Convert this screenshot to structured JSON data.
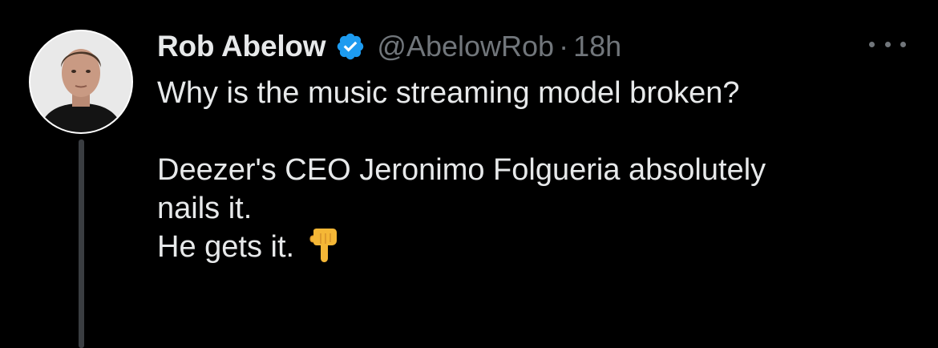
{
  "author": {
    "name": "Rob Abelow",
    "handle": "@AbelowRob",
    "separator": "·",
    "time": "18h",
    "verified": true,
    "avatar": "profile-photo"
  },
  "menu_icon": "more-horizontal-icon",
  "tweet": {
    "line1": "Why is the music streaming model broken?",
    "line2": "Deezer's CEO Jeronimo Folgueria absolutely",
    "line3": "nails it.",
    "line4": "He gets it.",
    "emoji": "backhand-index-pointing-down"
  },
  "colors": {
    "background": "#000000",
    "text": "#e7e9ea",
    "secondary": "#71767b",
    "verified": "#1d9bf0",
    "thread_line": "#3a3d41"
  }
}
